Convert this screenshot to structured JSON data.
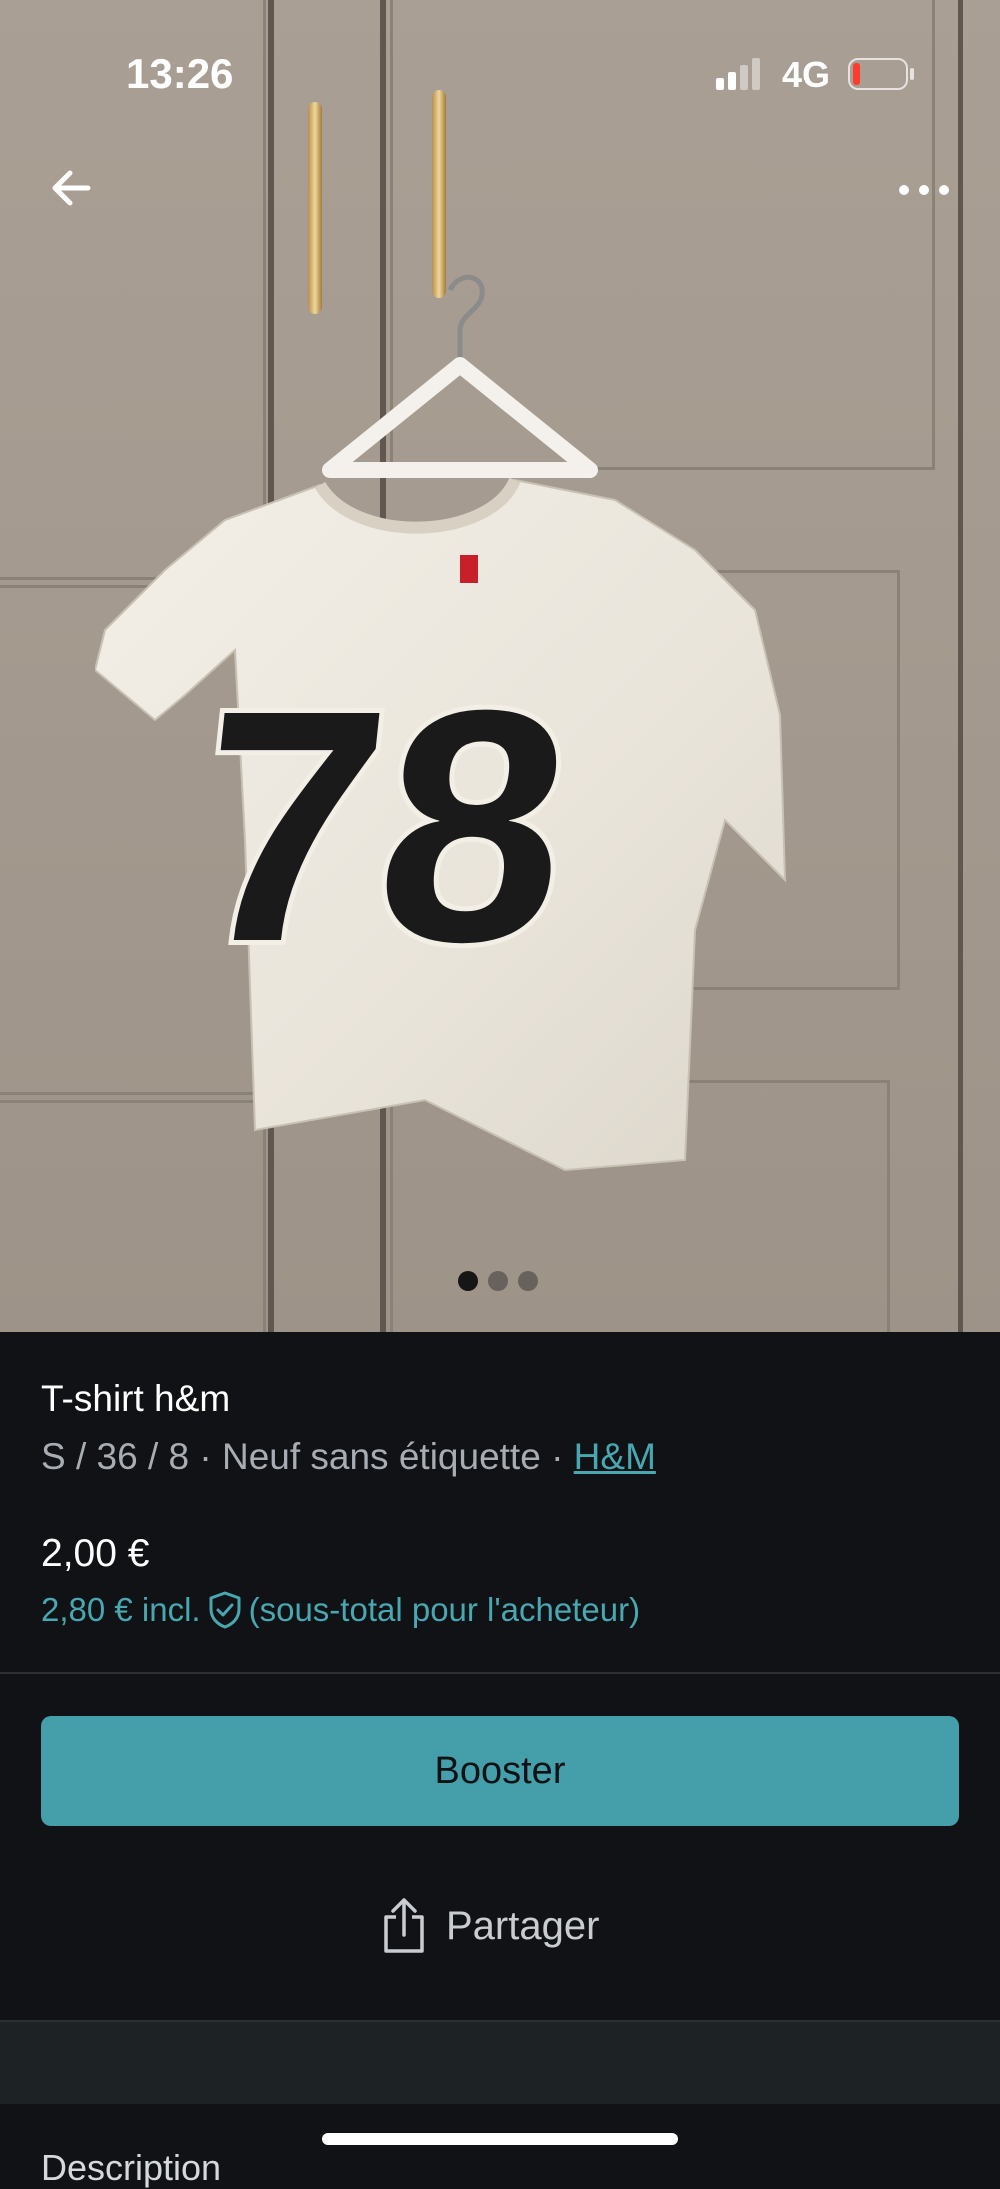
{
  "status_bar": {
    "time": "13:26",
    "network": "4G",
    "signal_bars_active": 2,
    "signal_bars_total": 4,
    "battery_level": 0.1,
    "battery_color": "#ff3b30"
  },
  "nav": {
    "back_icon": "arrow-left-icon",
    "more_icon": "more-horizontal-icon"
  },
  "gallery": {
    "image_count": 3,
    "active_index": 0,
    "shirt_print": "78"
  },
  "item": {
    "title": "T-shirt h&m",
    "size_condition": "S / 36 / 8 · Neuf sans étiquette · ",
    "brand": "H&M",
    "price": "2,00 €",
    "price_incl": "2,80 € incl.",
    "price_incl_note": "(sous-total pour l'acheteur)",
    "protection_icon": "shield-check-icon"
  },
  "actions": {
    "booster_label": "Booster",
    "share_label": "Partager",
    "share_icon": "share-icon"
  },
  "description": {
    "heading_peek": "Description"
  },
  "colors": {
    "accent": "#449faa",
    "link": "#48a7b1",
    "background": "#101215"
  }
}
